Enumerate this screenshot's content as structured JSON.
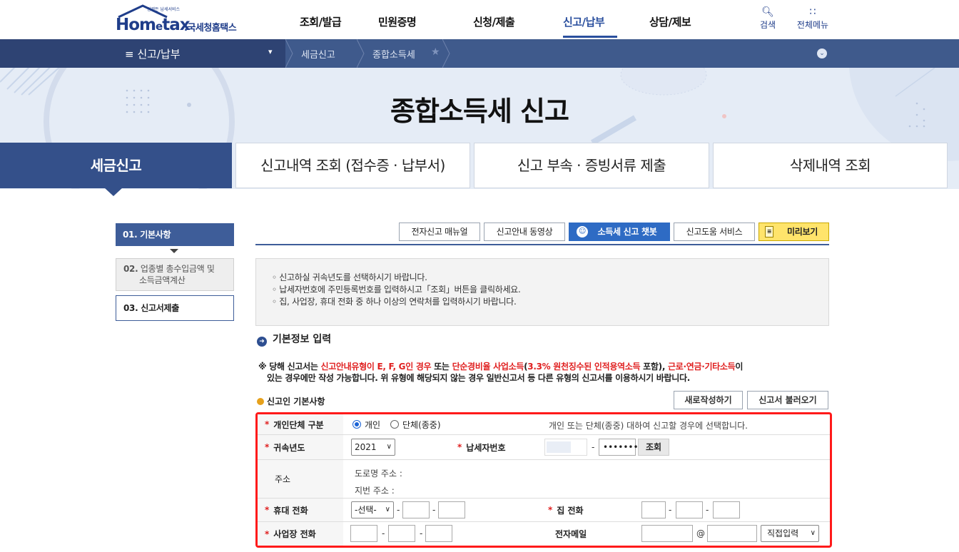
{
  "header": {
    "logo_brand": "Homtax",
    "logo_brand_e": "e",
    "logo_korean": ".국세청홈택스",
    "logo_tiny": "언제든 납세서비스",
    "gnb": [
      "조회/발급",
      "민원증명",
      "신청/제출",
      "신고/납부",
      "상담/제보"
    ],
    "tools": [
      {
        "label": "검색",
        "icon": "search-icon"
      },
      {
        "label": "전체메뉴",
        "icon": "grid-icon"
      }
    ]
  },
  "nav": {
    "menu": "≡ 신고/납부",
    "crumbs": [
      "세금신고",
      "종합소득세"
    ]
  },
  "hero": {
    "title": "종합소득세 신고"
  },
  "tabs": [
    "세금신고",
    "신고내역 조회 (접수증 · 납부서)",
    "신고 부속 · 증빙서류 제출",
    "삭제내역 조회"
  ],
  "steps": [
    {
      "num": "01.",
      "label": "기본사항"
    },
    {
      "num": "02.",
      "label": "업종별 총수입금액 및",
      "label2": "소득금액계산"
    },
    {
      "num": "03.",
      "label": "신고서제출"
    }
  ],
  "top_buttons": [
    "전자신고 매뉴얼",
    "신고안내 동영상",
    "소득세 신고 챗봇",
    "신고도움 서비스",
    "미리보기"
  ],
  "info": [
    "신고하실 귀속년도를 선택하시기 바랍니다.",
    "납세자번호에 주민등록번호를 입력하시고「조회」버튼을 클릭하세요.",
    "집, 사업장, 휴대 전화 중 하나 이상의 연락처를 입력하시기 바랍니다."
  ],
  "section_title": "기본정보 입력",
  "notice": {
    "p1": "※ 당해 신고서는 ",
    "r1": "신고안내유형이 E, F, G인 경우",
    "p2": " 또는 ",
    "r2": "단순경비율 사업소득",
    "p3": "(",
    "r3": "3.3% 원천징수된 인적용역소득",
    "p4": " 포함), ",
    "r4": "근로·연금·기타소득",
    "p5": "이",
    "line2": "있는 경우에만 작성 가능합니다. 위 유형에 해당되지 않는 경우 일반신고서 등 다른 유형의 신고서를 이용하시기 바랍니다."
  },
  "subsection": {
    "title": "신고인 기본사항",
    "btn_new": "새로작성하기",
    "btn_load": "신고서 불러오기"
  },
  "form": {
    "type_label": "개인단체 구분",
    "radio_individual": "개인",
    "radio_group": "단체(종중)",
    "type_hint": "개인 또는 단체(종중) 대하여 신고할 경우에 선택합니다.",
    "year_label": "귀속년도",
    "year_value": "2021",
    "taxpayer_label": "납세자번호",
    "taxpayer_masked": "•••••••",
    "lookup_btn": "조회",
    "addr_label": "주소",
    "road_addr": "도로명 주소 :",
    "lot_addr": "지번 주소 :",
    "mobile_label": "휴대 전화",
    "mobile_select": "-선택-",
    "home_label": "집 전화",
    "biz_label": "사업장 전화",
    "email_label": "전자메일",
    "email_at": "@",
    "email_domain_select": "직접입력",
    "dash": "-",
    "req": "*"
  }
}
